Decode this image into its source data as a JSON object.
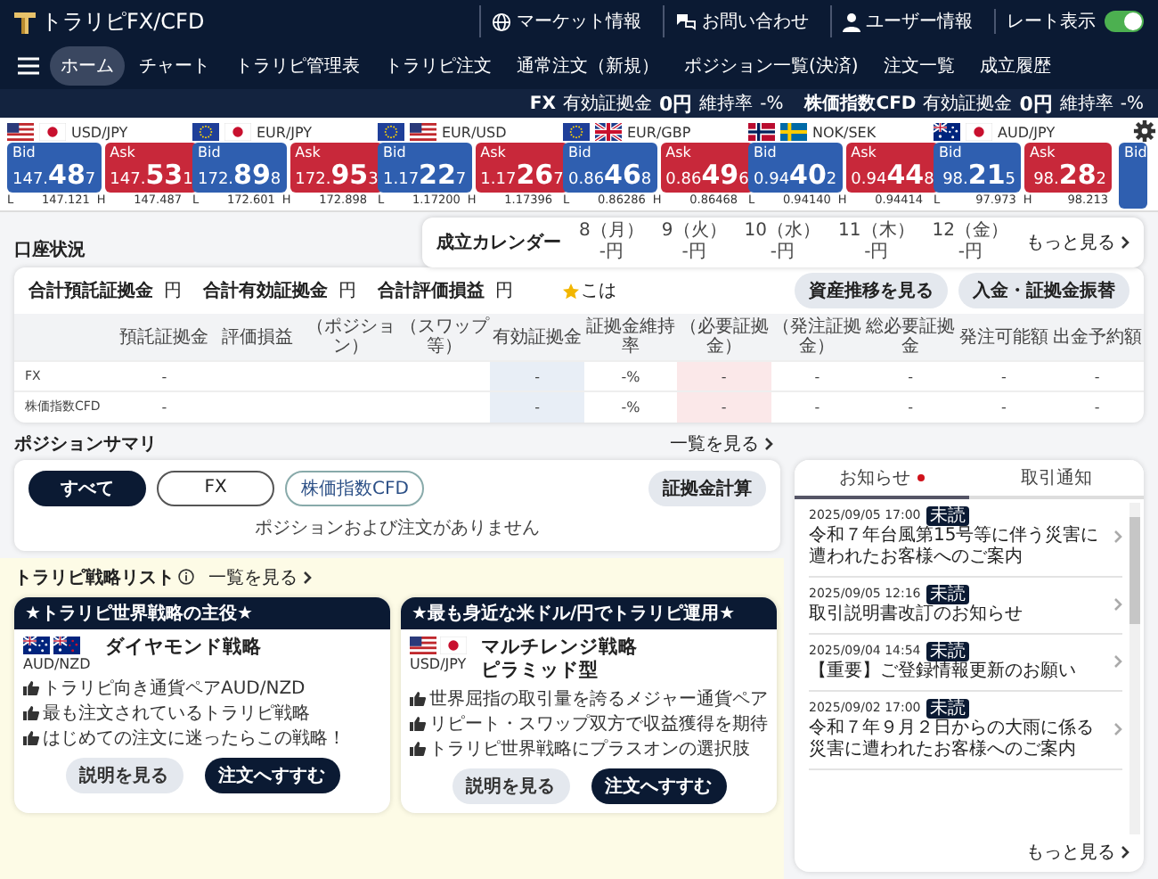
{
  "header": {
    "logo": "トラリピFX/CFD",
    "icon_links": [
      {
        "label": "マーケット情報"
      },
      {
        "label": "お問い合わせ"
      },
      {
        "label": "ユーザー情報"
      }
    ],
    "rate_toggle": {
      "label": "レート表示",
      "on": true
    },
    "menu": [
      {
        "label": "ホーム",
        "selected": true
      },
      {
        "label": "チャート",
        "selected": false
      },
      {
        "label": "トラリピ管理表",
        "selected": false
      },
      {
        "label": "トラリピ注文",
        "selected": false
      },
      {
        "label": "通常注文（新規）",
        "selected": false
      },
      {
        "label": "ポジション一覧(決済)",
        "selected": false
      },
      {
        "label": "注文一覧",
        "selected": false
      },
      {
        "label": "成立履歴",
        "selected": false
      }
    ],
    "account_stats": [
      {
        "market": "FX",
        "margin_label": "有効証拠金",
        "margin": "0円",
        "ratio_label": "維持率",
        "ratio": "-%"
      },
      {
        "market": "株価指数CFD",
        "margin_label": "有効証拠金",
        "margin": "0円",
        "ratio_label": "維持率",
        "ratio": "-%"
      }
    ]
  },
  "rates": [
    {
      "kind": "full",
      "pair": "USD/JPY",
      "flags": [
        {
          "kind": "us"
        },
        {
          "kind": "jp"
        }
      ],
      "bid_label": "Bid",
      "bid": "147.487",
      "ask_label": "Ask",
      "ask": "147.531",
      "low_label": "L",
      "low": "147.121",
      "high_label": "H",
      "high": "147.487"
    },
    {
      "kind": "full",
      "pair": "EUR/JPY",
      "flags": [
        {
          "kind": "eu"
        },
        {
          "kind": "jp"
        }
      ],
      "bid_label": "Bid",
      "bid": "172.898",
      "ask_label": "Ask",
      "ask": "172.953",
      "low_label": "L",
      "low": "172.601",
      "high_label": "H",
      "high": "172.898"
    },
    {
      "kind": "full",
      "pair": "EUR/USD",
      "flags": [
        {
          "kind": "eu"
        },
        {
          "kind": "us"
        }
      ],
      "bid_label": "Bid",
      "bid": "1.17227",
      "ask_label": "Ask",
      "ask": "1.17267",
      "low_label": "L",
      "low": "1.17200",
      "high_label": "H",
      "high": "1.17396"
    },
    {
      "kind": "full",
      "pair": "EUR/GBP",
      "flags": [
        {
          "kind": "eu"
        },
        {
          "kind": "gb"
        }
      ],
      "bid_label": "Bid",
      "bid": "0.86468",
      "ask_label": "Ask",
      "ask": "0.86496",
      "low_label": "L",
      "low": "0.86286",
      "high_label": "H",
      "high": "0.86468"
    },
    {
      "kind": "full",
      "pair": "NOK/SEK",
      "flags": [
        {
          "kind": "no"
        },
        {
          "kind": "se"
        }
      ],
      "bid_label": "Bid",
      "bid": "0.94402",
      "ask_label": "Ask",
      "ask": "0.94448",
      "low_label": "L",
      "low": "0.94140",
      "high_label": "H",
      "high": "0.94414"
    },
    {
      "kind": "full",
      "pair": "AUD/JPY",
      "flags": [
        {
          "kind": "au"
        },
        {
          "kind": "jp"
        }
      ],
      "bid_label": "Bid",
      "bid": "98.215",
      "ask_label": "Ask",
      "ask": "98.282",
      "low_label": "L",
      "low": "97.973",
      "high_label": "H",
      "high": "98.213"
    },
    {
      "kind": "partial",
      "bid_label": "Bid"
    }
  ],
  "calendar": {
    "title": "成立カレンダー",
    "days": [
      {
        "label": "8（月）",
        "value": "-円"
      },
      {
        "label": "9（火）",
        "value": "-円"
      },
      {
        "label": "10（水）",
        "value": "-円"
      },
      {
        "label": "11（木）",
        "value": "-円"
      },
      {
        "label": "12（金）",
        "value": "-円"
      }
    ],
    "more": "もっと見る"
  },
  "account": {
    "title": "口座状況",
    "totals": [
      {
        "label": "合計預託証拠金",
        "unit": "円"
      },
      {
        "label": "合計有効証拠金",
        "unit": "円"
      },
      {
        "label": "合計評価損益",
        "unit": "円"
      }
    ],
    "note": "こは",
    "buttons": [
      "資産推移を見る",
      "入金・証拠金振替"
    ],
    "table": {
      "columns": [
        {
          "label": "預託証拠金"
        },
        {
          "label": "評価損益"
        },
        {
          "label": "（ポジション）"
        },
        {
          "label": "（スワップ等）"
        },
        {
          "label": "有効証拠金",
          "color": "#e8eef6"
        },
        {
          "label": "証拠金維持率"
        },
        {
          "label": "（必要証拠金）",
          "color": "#fbe8e9"
        },
        {
          "label": "（発注証拠金）"
        },
        {
          "label": "総必要証拠金"
        },
        {
          "label": "発注可能額"
        },
        {
          "label": "出金予約額"
        }
      ],
      "rows": [
        {
          "label": "FX",
          "cells": [
            "-",
            null,
            null,
            null,
            "-",
            "-%",
            "-",
            "-",
            "-",
            "-",
            "-"
          ]
        },
        {
          "label": "株価指数CFD",
          "cells": [
            "-",
            null,
            null,
            null,
            "-",
            "-%",
            "-",
            "-",
            "-",
            "-",
            "-"
          ]
        }
      ]
    }
  },
  "position_summary": {
    "title": "ポジションサマリ",
    "more": "一覧を見る",
    "filters": [
      {
        "label": "すべて",
        "selected": true
      },
      {
        "label": "FX",
        "selected": false
      },
      {
        "label": "株価指数CFD",
        "selected": false
      }
    ],
    "calc_button": "証拠金計算",
    "empty_message": "ポジションおよび注文がありません"
  },
  "strategies": {
    "title": "トラリピ戦略リスト",
    "more": "一覧を見る",
    "cards": [
      {
        "banner": "★トラリピ世界戦略の主役★",
        "flags": [
          {
            "kind": "au"
          },
          {
            "kind": "nz"
          }
        ],
        "pair": "AUD/NZD",
        "name_lines": [
          "ダイヤモンド戦略"
        ],
        "points": [
          "トラリピ向き通貨ペアAUD/NZD",
          "最も注文されているトラリピ戦略",
          "はじめての注文に迷ったらこの戦略！"
        ],
        "buttons": [
          {
            "label": "説明を見る",
            "kind": "secondary"
          },
          {
            "label": "注文へすすむ",
            "kind": "primary"
          }
        ]
      },
      {
        "banner": "★最も身近な米ドル/円でトラリピ運用★",
        "flags": [
          {
            "kind": "us"
          },
          {
            "kind": "jp"
          }
        ],
        "pair": "USD/JPY",
        "name_lines": [
          "マルチレンジ戦略",
          "ピラミッド型"
        ],
        "points": [
          "世界屈指の取引量を誇るメジャー通貨ペア",
          "リピート・スワップ双方で収益獲得を期待",
          "トラリピ世界戦略にプラスオンの選択肢"
        ],
        "buttons": [
          {
            "label": "説明を見る",
            "kind": "secondary"
          },
          {
            "label": "注文へすすむ",
            "kind": "primary"
          }
        ]
      }
    ]
  },
  "news": {
    "tabs": [
      {
        "label": "お知らせ",
        "selected": true,
        "unread_dot": true
      },
      {
        "label": "取引通知",
        "selected": false,
        "unread_dot": false
      }
    ],
    "items": [
      {
        "date": "2025/09/05 17:00",
        "badge": "未読",
        "title": "令和７年台風第15号等に伴う災害に遭われたお客様へのご案内"
      },
      {
        "date": "2025/09/05 12:16",
        "badge": "未読",
        "title": "取引説明書改訂のお知らせ"
      },
      {
        "date": "2025/09/04 14:54",
        "badge": "未読",
        "title": "【重要】ご登録情報更新のお願い"
      },
      {
        "date": "2025/09/02 17:00",
        "badge": "未読",
        "title": "令和７年９月２日からの大雨に係る災害に遭われたお客様へのご案内"
      }
    ],
    "more": "もっと見る"
  }
}
